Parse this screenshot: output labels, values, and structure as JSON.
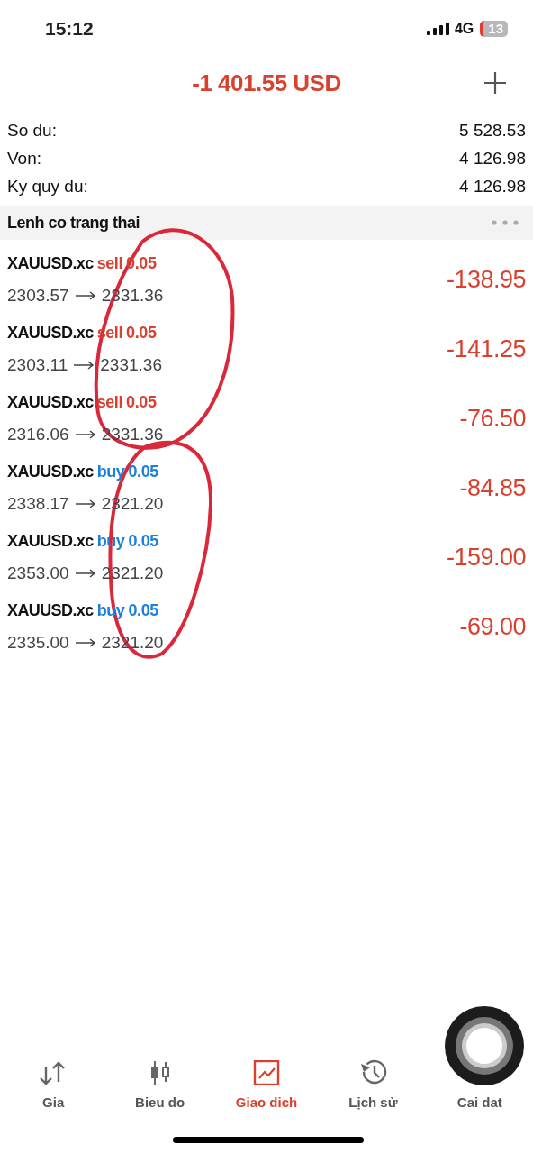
{
  "status_bar": {
    "time": "15:12",
    "network": "4G",
    "battery": "13"
  },
  "header": {
    "title": "-1 401.55 USD"
  },
  "summary": [
    {
      "label": "So du:",
      "value": "5 528.53"
    },
    {
      "label": "Von:",
      "value": "4 126.98"
    },
    {
      "label": "Ky quy du:",
      "value": "4 126.98"
    }
  ],
  "section": {
    "title": "Lenh co trang thai"
  },
  "positions": [
    {
      "symbol": "XAUUSD.xc",
      "direction": "sell",
      "volume": "0.05",
      "open_price": "2303.57",
      "current_price": "2331.36",
      "profit": "-138.95"
    },
    {
      "symbol": "XAUUSD.xc",
      "direction": "sell",
      "volume": "0.05",
      "open_price": "2303.11",
      "current_price": "2331.36",
      "profit": "-141.25"
    },
    {
      "symbol": "XAUUSD.xc",
      "direction": "sell",
      "volume": "0.05",
      "open_price": "2316.06",
      "current_price": "2331.36",
      "profit": "-76.50"
    },
    {
      "symbol": "XAUUSD.xc",
      "direction": "buy",
      "volume": "0.05",
      "open_price": "2338.17",
      "current_price": "2321.20",
      "profit": "-84.85"
    },
    {
      "symbol": "XAUUSD.xc",
      "direction": "buy",
      "volume": "0.05",
      "open_price": "2353.00",
      "current_price": "2321.20",
      "profit": "-159.00"
    },
    {
      "symbol": "XAUUSD.xc",
      "direction": "buy",
      "volume": "0.05",
      "open_price": "2335.00",
      "current_price": "2321.20",
      "profit": "-69.00"
    }
  ],
  "tab_bar": [
    {
      "label": "Gia",
      "selected": false
    },
    {
      "label": "Bieu do",
      "selected": false
    },
    {
      "label": "Giao dich",
      "selected": true
    },
    {
      "label": "Lịch sử",
      "selected": false
    },
    {
      "label": "Cai dat",
      "selected": false
    }
  ]
}
